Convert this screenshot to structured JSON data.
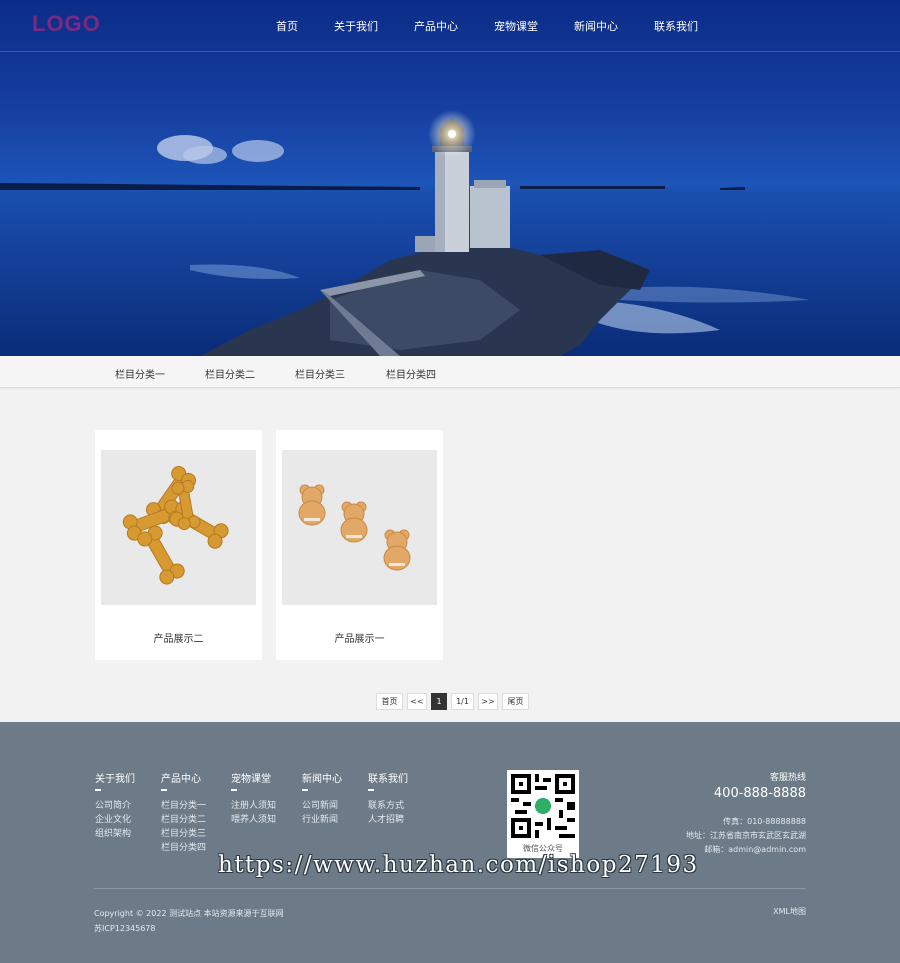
{
  "header": {
    "logo": "LOGO",
    "nav": [
      "首页",
      "关于我们",
      "产品中心",
      "宠物课堂",
      "新闻中心",
      "联系我们"
    ]
  },
  "subnav": [
    "栏目分类一",
    "栏目分类二",
    "栏目分类三",
    "栏目分类四"
  ],
  "products": [
    {
      "caption": "产品展示二",
      "image": "bone-biscuits"
    },
    {
      "caption": "产品展示一",
      "image": "bear-biscuits"
    }
  ],
  "pagination": {
    "first": "首页",
    "prev": "<<",
    "current": "1",
    "info": "1/1",
    "next": ">>",
    "last": "尾页"
  },
  "footer": {
    "columns": [
      {
        "title": "关于我们",
        "links": [
          "公司简介",
          "企业文化",
          "组织架构"
        ]
      },
      {
        "title": "产品中心",
        "links": [
          "栏目分类一",
          "栏目分类二",
          "栏目分类三",
          "栏目分类四"
        ]
      },
      {
        "title": "宠物课堂",
        "links": [
          "注册人须知",
          "喂养人须知"
        ]
      },
      {
        "title": "新闻中心",
        "links": [
          "公司新闻",
          "行业新闻"
        ]
      },
      {
        "title": "联系我们",
        "links": [
          "联系方式",
          "人才招聘"
        ]
      }
    ],
    "qr_caption": "微信公众号",
    "hotline_label": "客服热线",
    "hotline": "400-888-8888",
    "fax": "传真：010-88888888",
    "address": "地址：江苏省南京市玄武区玄武湖",
    "email": "邮箱：admin@admin.com",
    "copyright": "Copyright © 2022 测试站点 本站资源来源于互联网",
    "icp": "苏ICP12345678",
    "xml": "XML地图"
  },
  "watermark": "https://www.huzhan.com/ishop27193",
  "colors": {
    "banner": "#153e9f",
    "footer": "#6d7b88",
    "logo": "#7a2a82"
  }
}
